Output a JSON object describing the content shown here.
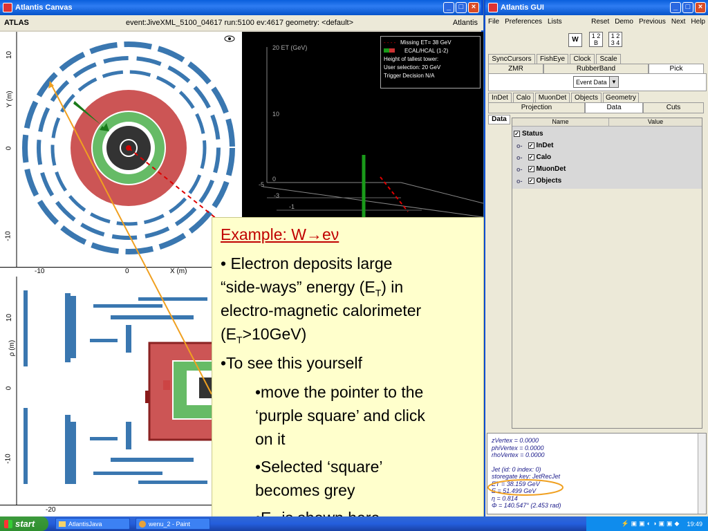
{
  "canvas_window": {
    "title": "Atlantis Canvas",
    "bar_left": "ATLAS",
    "bar_center": "event:JiveXML_5100_04617 run:5100 ev:4617  geometry: <default>",
    "bar_right": "Atlantis",
    "xy_view": {
      "y_axis_label": "Y (m)",
      "x_axis_label": "X (m)",
      "y_ticks": [
        "10",
        "0",
        "-10"
      ],
      "x_ticks": [
        "-10",
        "0"
      ]
    },
    "lego_view": {
      "legend": [
        "Missing ET= 38 GeV",
        "ECAL/HCAL (1-2)",
        "Height of tallest tower:",
        "User selection: 20 GeV",
        "Trigger Decision N/A"
      ],
      "z_ticks": [
        "20 ET (GeV)",
        "10",
        "0"
      ],
      "grid_labels": [
        "-5",
        "-3",
        "-1"
      ]
    },
    "rz_view": {
      "y_axis_label": "ρ (m)",
      "y_ticks": [
        "10",
        "0",
        "-10"
      ],
      "x_ticks": [
        "-20"
      ]
    }
  },
  "gui_window": {
    "title": "Atlantis GUI",
    "menu": [
      "File",
      "Preferences",
      "Lists"
    ],
    "menu_right": [
      "Reset",
      "Demo",
      "Previous",
      "Next",
      "Help"
    ],
    "w_button": "W",
    "layout_buttons": [
      "1 2\nB",
      "1 2\n3 4"
    ],
    "tabs_row1": [
      "SyncCursors",
      "FishEye",
      "Clock",
      "Scale"
    ],
    "tabs_row2": [
      "ZMR",
      "RubberBand",
      "Pick"
    ],
    "event_data_select": "Event Data",
    "tabs_row3": [
      "InDet",
      "Calo",
      "MuonDet",
      "Objects",
      "Geometry"
    ],
    "tabs_row4": [
      "Projection",
      "Data",
      "Cuts"
    ],
    "side_tab": "Data",
    "table_headers": [
      "Name",
      "Value"
    ],
    "tree": [
      "Status",
      "InDet",
      "Calo",
      "MuonDet",
      "Objects"
    ],
    "output_lines": [
      "zVertex = 0.0000",
      "phiVertex = 0.0000",
      "rhoVertex = 0.0000",
      "",
      "Jet (id: 0 index: 0)",
      "storegate key: JetRecJet",
      "ET  = 38.159 GeV",
      "E  = 51.499 GeV",
      "η = 0.814",
      "Φ = 140.547°  (2.453 rad)"
    ]
  },
  "note": {
    "heading": "Example: W→eν",
    "bullet1_a": "• Electron deposits large",
    "bullet1_b": "“side-ways” energy (E",
    "bullet1_b_sub": "T",
    "bullet1_b_end": ") in",
    "bullet1_c": "electro-magnetic calorimeter",
    "bullet1_d": "(E",
    "bullet1_d_sub": "T",
    "bullet1_d_end": ">10GeV)",
    "bullet2": "•To see this yourself",
    "sub1_a": "•move the pointer to the",
    "sub1_b": "‘purple square’ and click",
    "sub1_c": "on it",
    "sub2_a": "•Selected ‘square’",
    "sub2_b": "becomes grey",
    "sub3": "•E",
    "sub3_sub": "T",
    "sub3_end": " is shown here"
  },
  "taskbar": {
    "start": "start",
    "items": [
      "AtlantisJava",
      "wenu_2 - Paint"
    ],
    "clock": "19:49"
  },
  "colors": {
    "calo_red": "#cc5555",
    "calo_green": "#66bb66",
    "pointer_line": "#f0a020",
    "note_bg": "#ffffcc"
  }
}
